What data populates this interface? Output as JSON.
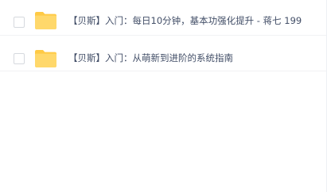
{
  "files": [
    {
      "name": "【贝斯】入门：每日10分钟，基本功强化提升 - 蒋七 199",
      "type": "folder",
      "icon": "folder-icon",
      "checked": false
    },
    {
      "name": "【贝斯】入门：从萌新到进阶的系统指南",
      "type": "folder",
      "icon": "folder-icon",
      "checked": false
    }
  ],
  "colors": {
    "folder": "#ffd86b",
    "folder_tab": "#ffca45",
    "text": "#424e67",
    "divider": "#f1f2f4"
  }
}
